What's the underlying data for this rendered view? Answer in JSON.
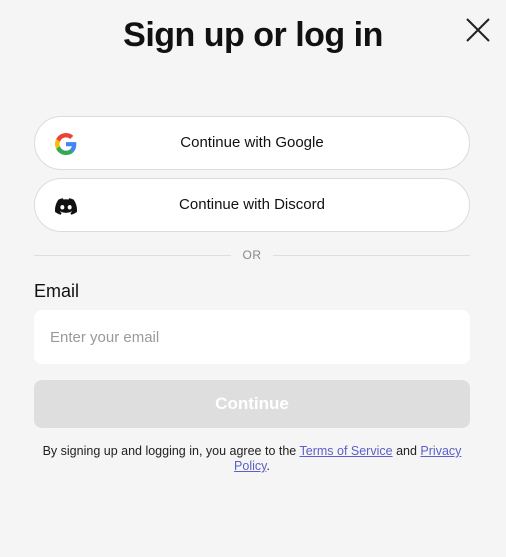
{
  "dialog": {
    "title": "Sign up or log in",
    "close_icon": "close-icon"
  },
  "oauth": {
    "google": {
      "label": "Continue with Google",
      "icon": "google-icon"
    },
    "discord": {
      "label": "Continue with Discord",
      "icon": "discord-icon"
    }
  },
  "divider": {
    "text": "OR"
  },
  "email": {
    "label": "Email",
    "placeholder": "Enter your email",
    "value": ""
  },
  "continue_button": {
    "label": "Continue",
    "disabled": true
  },
  "terms": {
    "prefix": "By signing up and logging in, you agree to the",
    "terms_link": "Terms of Service",
    "and": "and",
    "privacy_link": "Privacy Policy",
    "suffix": "."
  },
  "colors": {
    "background": "#f5f5f5",
    "link": "#5b5fc7",
    "button_disabled": "#dedede"
  }
}
